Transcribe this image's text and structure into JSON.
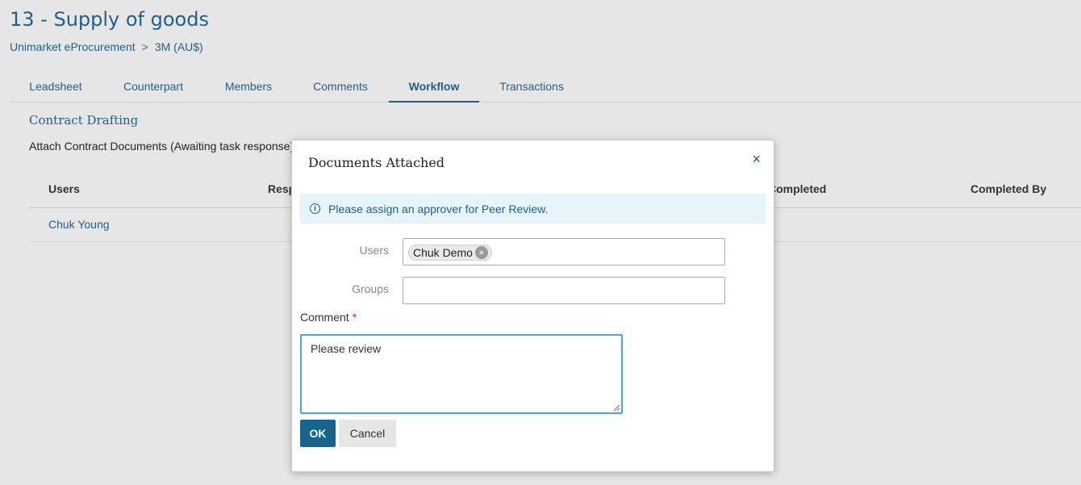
{
  "header": {
    "title": "13 - Supply of goods",
    "breadcrumb": [
      "Unimarket eProcurement",
      "3M (AU$)"
    ],
    "breadcrumb_separator": ">"
  },
  "tabs": [
    {
      "label": "Leadsheet",
      "active": false
    },
    {
      "label": "Counterpart",
      "active": false
    },
    {
      "label": "Members",
      "active": false
    },
    {
      "label": "Comments",
      "active": false
    },
    {
      "label": "Workflow",
      "active": true
    },
    {
      "label": "Transactions",
      "active": false
    }
  ],
  "workflow": {
    "section_title": "Contract Drafting",
    "task_text": "Attach Contract Documents (Awaiting task response)",
    "table": {
      "headers": [
        "Users",
        "Resp",
        "Completed",
        "Completed By"
      ],
      "rows": [
        {
          "user": "Chuk Young"
        }
      ]
    }
  },
  "modal": {
    "title": "Documents Attached",
    "close_glyph": "×",
    "alert_text": "Please assign an approver for Peer Review.",
    "users_label": "Users",
    "users_selected": [
      "Chuk Demo"
    ],
    "groups_label": "Groups",
    "groups_value": "",
    "comment_label": "Comment",
    "required_mark": "*",
    "comment_value": "Please review",
    "ok_label": "OK",
    "cancel_label": "Cancel"
  },
  "colors": {
    "brand": "#1f5f8b",
    "ok_button": "#17658f",
    "alert_bg": "#e7f4fa",
    "focus_border": "#4aa8c8",
    "required": "#c0392b"
  },
  "icons": {
    "close": "close-icon",
    "info": "info-icon",
    "chip_remove": "remove-chip-icon"
  }
}
